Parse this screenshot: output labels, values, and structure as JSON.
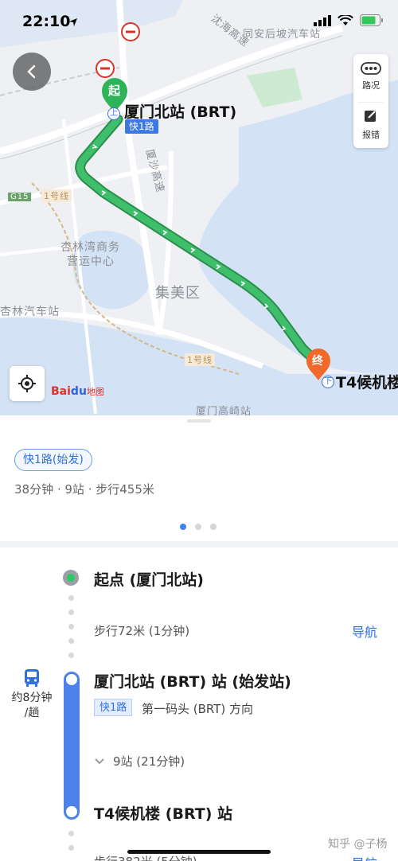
{
  "status": {
    "time": "22:10"
  },
  "map": {
    "labels": {
      "highway_a": "沈海高速",
      "highway_b": "厦沙高速",
      "village": "同安后坡汽车站",
      "line1_top": "1号线",
      "line1_bottom": "1号线",
      "xinglin_1": "杏林湾商务",
      "xinglin_2": "营运中心",
      "district": "集美区",
      "bus_station": "杏林汽车站",
      "g15": "G15",
      "gaoqi": "厦门高崎站"
    },
    "start_marker": "起",
    "end_marker": "终",
    "start_station": "厦门北站 (BRT)",
    "end_station": "T4候机楼",
    "start_badge": "快1路",
    "stop_up": "上",
    "stop_down": "下",
    "side_panel": {
      "traffic": "路况",
      "report": "报错"
    },
    "baidu_logo": {
      "bai": "Bai",
      "du": "du",
      "map": "地图"
    },
    "route_color": "#3fbe6b"
  },
  "card": {
    "route_tag": "快1路(始发)",
    "meta": "38分钟 · 9站 · 步行455米",
    "pages": 3,
    "active_page": 1
  },
  "steps": {
    "start_title": "起点 (厦门北站)",
    "walk1": "步行72米 (1分钟)",
    "walk1_nav": "导航",
    "board_title": "厦门北站 (BRT) 站 (始发站)",
    "line_badge": "快1路",
    "line_direction": "第一码头 (BRT) 方向",
    "stops": "9站 (21分钟)",
    "frequency_1": "约8分钟",
    "frequency_2": "/趟",
    "alight_title": "T4候机楼 (BRT) 站",
    "walk2": "步行382米 (5分钟)",
    "walk2_nav": "导航"
  },
  "watermark": "知乎 @子杨"
}
